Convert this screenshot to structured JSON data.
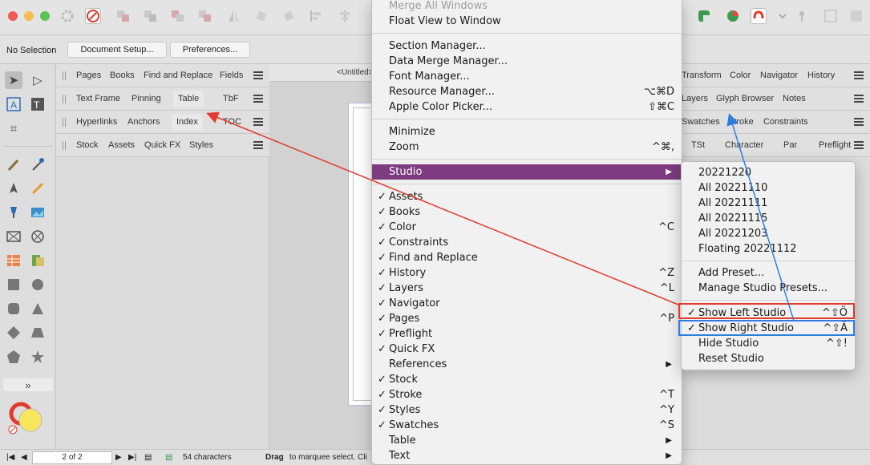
{
  "toolbar": {
    "traffic_colors": [
      "#ee5c54",
      "#f6be50",
      "#5ec454"
    ],
    "context": {
      "selection_label": "No Selection",
      "document_setup": "Document Setup...",
      "preferences": "Preferences..."
    }
  },
  "left_studio": {
    "rows": [
      [
        "Pages",
        "Books",
        "Find and Replace",
        "Fields"
      ],
      [
        "Text Frame",
        "Pinning",
        "Table",
        "TbF"
      ],
      [
        "Hyperlinks",
        "Anchors",
        "Index",
        "TOC"
      ],
      [
        "Stock",
        "Assets",
        "Quick FX",
        "Styles"
      ]
    ]
  },
  "document": {
    "tab_title": "<Untitled>"
  },
  "right_studio": {
    "rows": [
      [
        "Transform",
        "Color",
        "Navigator",
        "History"
      ],
      [
        "Layers",
        "Glyph Browser",
        "Notes"
      ],
      [
        "Swatches",
        "Stroke",
        "Constraints"
      ],
      [
        "TSt",
        "Character",
        "Par",
        "Preflight"
      ]
    ]
  },
  "window_menu": {
    "top_items": [
      {
        "label": "Merge All Windows",
        "shortcut": "",
        "disabled": true
      },
      {
        "label": "Float View to Window",
        "shortcut": "",
        "disabled": false
      }
    ],
    "manager_items": [
      {
        "label": "Section Manager...",
        "shortcut": ""
      },
      {
        "label": "Data Merge Manager...",
        "shortcut": ""
      },
      {
        "label": "Font Manager...",
        "shortcut": ""
      },
      {
        "label": "Resource Manager...",
        "shortcut": "⌥⌘D"
      },
      {
        "label": "Apple Color Picker...",
        "shortcut": "⇧⌘C"
      }
    ],
    "window_items": [
      {
        "label": "Minimize",
        "shortcut": ""
      },
      {
        "label": "Zoom",
        "shortcut": "^⌘,"
      }
    ],
    "studio_label": "Studio",
    "panel_items": [
      {
        "label": "Assets",
        "checked": true,
        "shortcut": ""
      },
      {
        "label": "Books",
        "checked": true,
        "shortcut": ""
      },
      {
        "label": "Color",
        "checked": true,
        "shortcut": "^C"
      },
      {
        "label": "Constraints",
        "checked": true,
        "shortcut": ""
      },
      {
        "label": "Find and Replace",
        "checked": true,
        "shortcut": ""
      },
      {
        "label": "History",
        "checked": true,
        "shortcut": "^Z"
      },
      {
        "label": "Layers",
        "checked": true,
        "shortcut": "^L"
      },
      {
        "label": "Navigator",
        "checked": true,
        "shortcut": ""
      },
      {
        "label": "Pages",
        "checked": true,
        "shortcut": "^P"
      },
      {
        "label": "Preflight",
        "checked": true,
        "shortcut": ""
      },
      {
        "label": "Quick FX",
        "checked": true,
        "shortcut": ""
      },
      {
        "label": "References",
        "checked": false,
        "shortcut": "",
        "submenu": true
      },
      {
        "label": "Stock",
        "checked": true,
        "shortcut": ""
      },
      {
        "label": "Stroke",
        "checked": true,
        "shortcut": "^T"
      },
      {
        "label": "Styles",
        "checked": true,
        "shortcut": "^Y"
      },
      {
        "label": "Swatches",
        "checked": true,
        "shortcut": "^S"
      },
      {
        "label": "Table",
        "checked": false,
        "shortcut": "",
        "submenu": true
      },
      {
        "label": "Text",
        "checked": false,
        "shortcut": "",
        "submenu": true
      }
    ]
  },
  "studio_submenu": {
    "presets": [
      "20221220",
      "All 20221110",
      "All 20221111",
      "All 20221115",
      "All 20221203",
      "Floating 20221112"
    ],
    "preset_actions": [
      "Add Preset...",
      "Manage Studio Presets..."
    ],
    "visibility": [
      {
        "label": "Show Left Studio",
        "checked": true,
        "shortcut": "^⇧Ö"
      },
      {
        "label": "Show Right Studio",
        "checked": true,
        "shortcut": "^⇧Ä"
      },
      {
        "label": "Hide Studio",
        "checked": false,
        "shortcut": "^⇧!"
      },
      {
        "label": "Reset Studio",
        "checked": false,
        "shortcut": ""
      }
    ]
  },
  "status": {
    "page_field": "2 of 2",
    "characters": "54 characters",
    "hint_bold": "Drag",
    "hint_rest": "to marquee select. Cli"
  },
  "colors": {
    "menu_highlight": "#7d3b80",
    "annotation_red": "#e23b2e",
    "annotation_blue": "#2f7de0"
  }
}
